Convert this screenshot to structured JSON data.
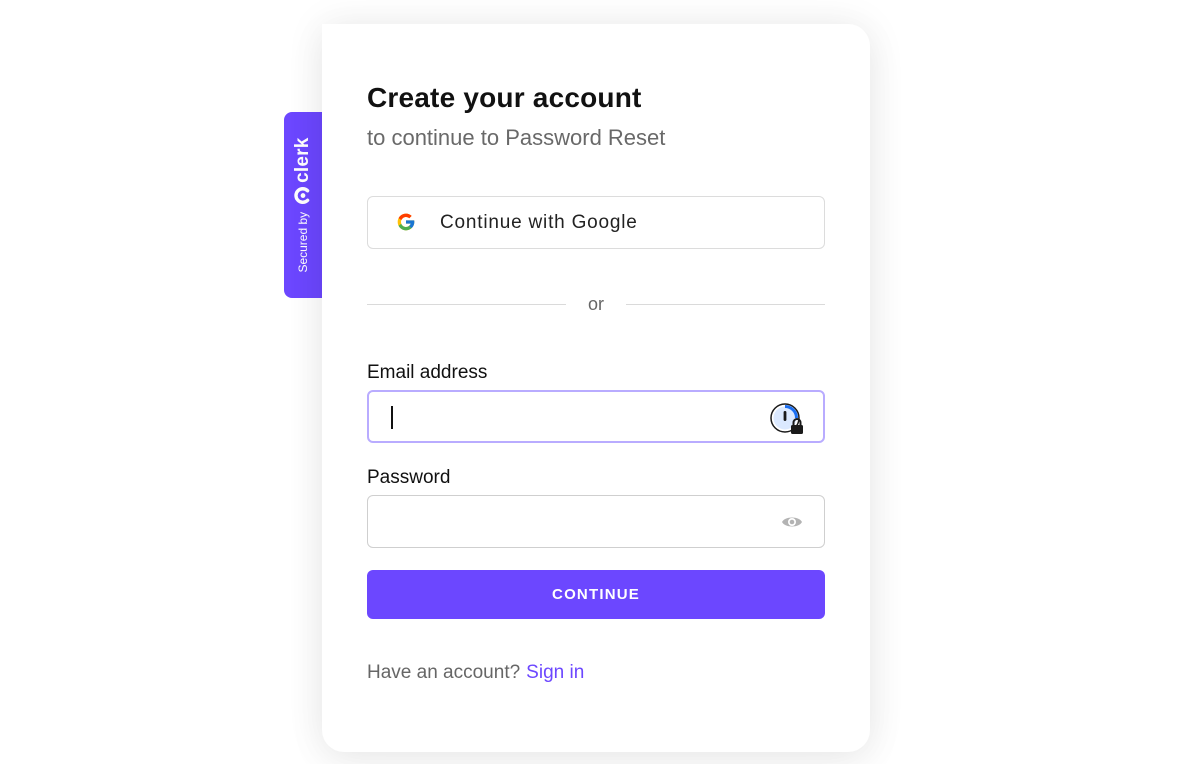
{
  "badge": {
    "secured_text": "Secured by",
    "brand": "clerk",
    "logo_icon": "clerk-logo-icon"
  },
  "card": {
    "title": "Create your account",
    "subtitle": "to continue to Password Reset"
  },
  "social": {
    "google_label": "Continue with Google",
    "google_icon": "google-g-icon"
  },
  "divider": {
    "text": "or"
  },
  "form": {
    "email": {
      "label": "Email address",
      "value": "",
      "state": "focused",
      "addon_icon": "password-manager-lock-icon"
    },
    "password": {
      "label": "Password",
      "value": "",
      "addon_icon": "eye-icon"
    },
    "continue_label": "CONTINUE"
  },
  "footer": {
    "prompt": "Have an account?",
    "link": "Sign in"
  },
  "colors": {
    "accent": "#6c47ff",
    "focus_border": "#b9acff",
    "text_primary": "#111111",
    "text_secondary": "#696969"
  }
}
